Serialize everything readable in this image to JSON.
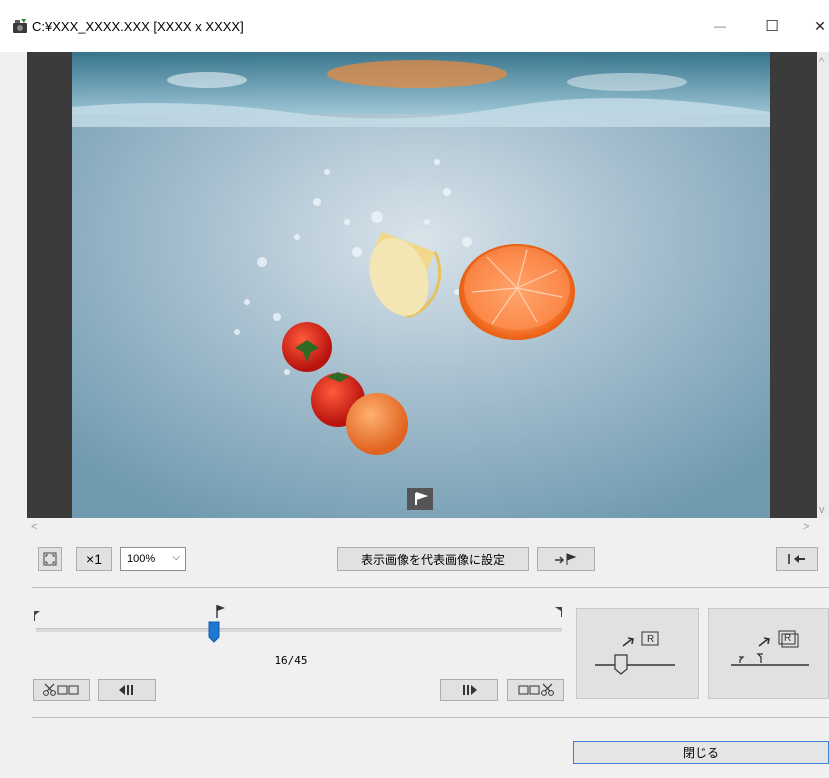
{
  "window": {
    "title": "C:¥XXX_XXXX.XXX [XXXX x XXXX]",
    "minimize_glyph": "—",
    "maximize_glyph": "☐",
    "close_glyph": "✕"
  },
  "toolbar": {
    "fit_icon": "fit-screen-icon",
    "actual_size_label": "×1",
    "zoom_value": "100%",
    "zoom_chevron": "⌵",
    "set_representative_label": "表示画像を代表画像に設定",
    "go_to_marker_icon": "arrow-flag-icon",
    "back_icon": "back-to-start-icon"
  },
  "timeline": {
    "frame_counter": "16/45",
    "current_frame": 16,
    "total_frames": 45
  },
  "actions": {
    "close_label": "閉じる"
  },
  "colors": {
    "accent": "#1e78d2",
    "focus_border": "#3c7fd7",
    "water_top": "#9fb9c9",
    "water_bottom": "#6e9cb2"
  }
}
